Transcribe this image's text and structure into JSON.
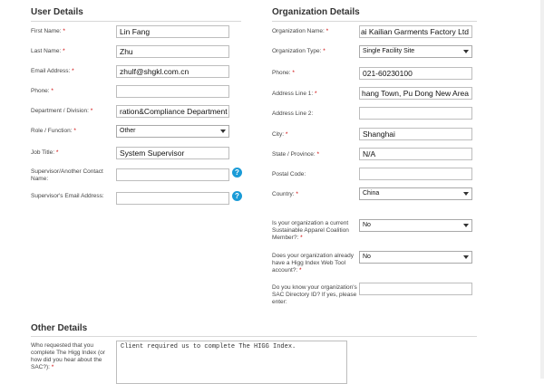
{
  "user_details": {
    "title": "User Details",
    "fields": [
      {
        "label": "First Name:",
        "required": true,
        "value": "Lin Fang"
      },
      {
        "label": "Last Name:",
        "required": true,
        "value": "Zhu"
      },
      {
        "label": "Email Address:",
        "required": true,
        "value": "zhulf@shgkl.com.cn"
      },
      {
        "label": "Phone:",
        "required": true,
        "value": ""
      },
      {
        "label": "Department / Division:",
        "required": true,
        "value": "ration&Compliance Department"
      },
      {
        "label": "Role / Function:",
        "required": true,
        "value": "Other"
      },
      {
        "label": "Job Title:",
        "required": true,
        "value": "System Supervisor"
      },
      {
        "label": "Supervisor/Another Contact Name:",
        "required": false,
        "value": ""
      },
      {
        "label": "Supervisor's Email Address:",
        "required": false,
        "value": ""
      }
    ]
  },
  "organization_details": {
    "title": "Organization Details",
    "fields": [
      {
        "label": "Organization Name:",
        "required": true,
        "value": "ai Kailian Garments Factory Ltd"
      },
      {
        "label": "Organization Type:",
        "required": true,
        "value": "Single Facility Site"
      },
      {
        "label": "Phone:",
        "required": true,
        "value": "021-60230100"
      },
      {
        "label": "Address Line 1:",
        "required": true,
        "value": "hang Town, Pu Dong New Area"
      },
      {
        "label": "Address Line 2:",
        "required": false,
        "value": ""
      },
      {
        "label": "City:",
        "required": true,
        "value": "Shanghai"
      },
      {
        "label": "State / Province:",
        "required": true,
        "value": "N/A"
      },
      {
        "label": "Postal Code:",
        "required": false,
        "value": ""
      },
      {
        "label": "Country:",
        "required": true,
        "value": "China"
      },
      {
        "label": "Is your organization a current Sustainable Apparel Coalition Member?:",
        "required": true,
        "value": "No"
      },
      {
        "label": "Does your organization already have a Higg Index Web Tool account?:",
        "required": true,
        "value": "No"
      },
      {
        "label": "Do you know your organization's SAC Directory ID? If yes, please enter:",
        "required": false,
        "value": ""
      }
    ]
  },
  "other_details": {
    "title": "Other Details",
    "question": "Who requested that you complete The Higg Index (or how did you hear about the SAC?):",
    "required": true,
    "answer": "Client required us to complete The HIGG Index."
  },
  "required_marker": "*",
  "help_glyph": "?",
  "colors": {
    "required": "#cc0000",
    "help": "#1a9bd7"
  }
}
